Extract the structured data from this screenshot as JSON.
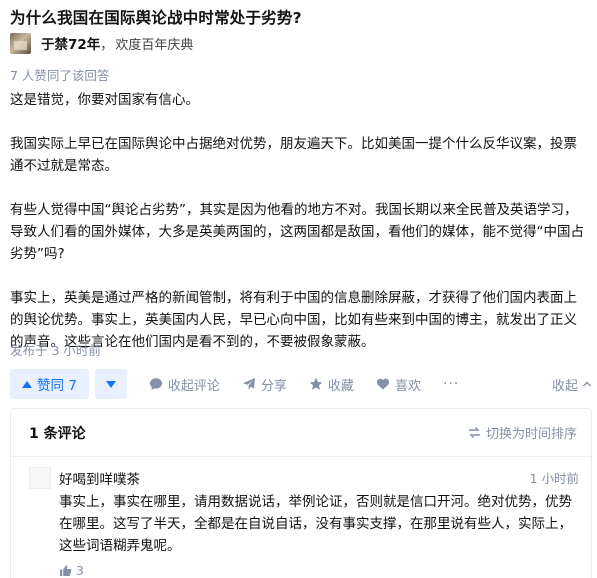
{
  "question": {
    "title": "为什么我国在国际舆论战中时常处于劣势?"
  },
  "author": {
    "name": "于禁72年",
    "separator": "，",
    "bio": "欢度百年庆典"
  },
  "answer": {
    "vote_summary": "7 人赞同了该回答",
    "paragraphs": [
      "这是错觉，你要对国家有信心。",
      "我国实际上早已在国际舆论中占据绝对优势，朋友遍天下。比如美国一提个什么反华议案，投票通不过就是常态。",
      "有些人觉得中国“舆论占劣势”，其实是因为他看的地方不对。我国长期以来全民普及英语学习，导致人们看的国外媒体，大多是英美两国的，这两国都是敌国，看他们的媒体，能不觉得“中国占劣势”吗?",
      "事实上，英美是通过严格的新闻管制，将有利于中国的信息删除屏蔽，才获得了他们国内表面上的舆论优势。事实上，英美国内人民，早已心向中国，比如有些来到中国的博主，就发出了正义的声音。这些言论在他们国内是看不到的，不要被假象蒙蔽。"
    ],
    "publish_time": "发布于 3 小时前"
  },
  "actions": {
    "vote_up_label": "赞同 7",
    "comment_label": "收起评论",
    "share_label": "分享",
    "favorite_label": "收藏",
    "like_label": "喜欢",
    "more_label": "···",
    "collapse_label": "收起"
  },
  "comments": {
    "count_label": "1 条评论",
    "sort_label": "切换为时间排序",
    "items": [
      {
        "author": "好喝到咩噗茶",
        "time": "1 小时前",
        "text": "事实上，事实在哪里，请用数据说话，举例论证，否则就是信口开河。绝对优势，优势在哪里。这写了半天，全都是在自说自话，没有事实支撑，在那里说有些人，实际上，这些词语糊弄鬼呢。",
        "likes": "3"
      }
    ]
  },
  "colors": {
    "accent": "#1772f6",
    "accent_bg": "#e8f0fd",
    "muted": "#8590a6",
    "text": "#121212"
  },
  "icons": [
    "avatar",
    "triangle-up-icon",
    "triangle-down-icon",
    "comment-icon",
    "share-icon",
    "star-icon",
    "heart-icon",
    "more-icon",
    "chevron-up-icon",
    "swap-icon",
    "thumbs-up-icon"
  ]
}
